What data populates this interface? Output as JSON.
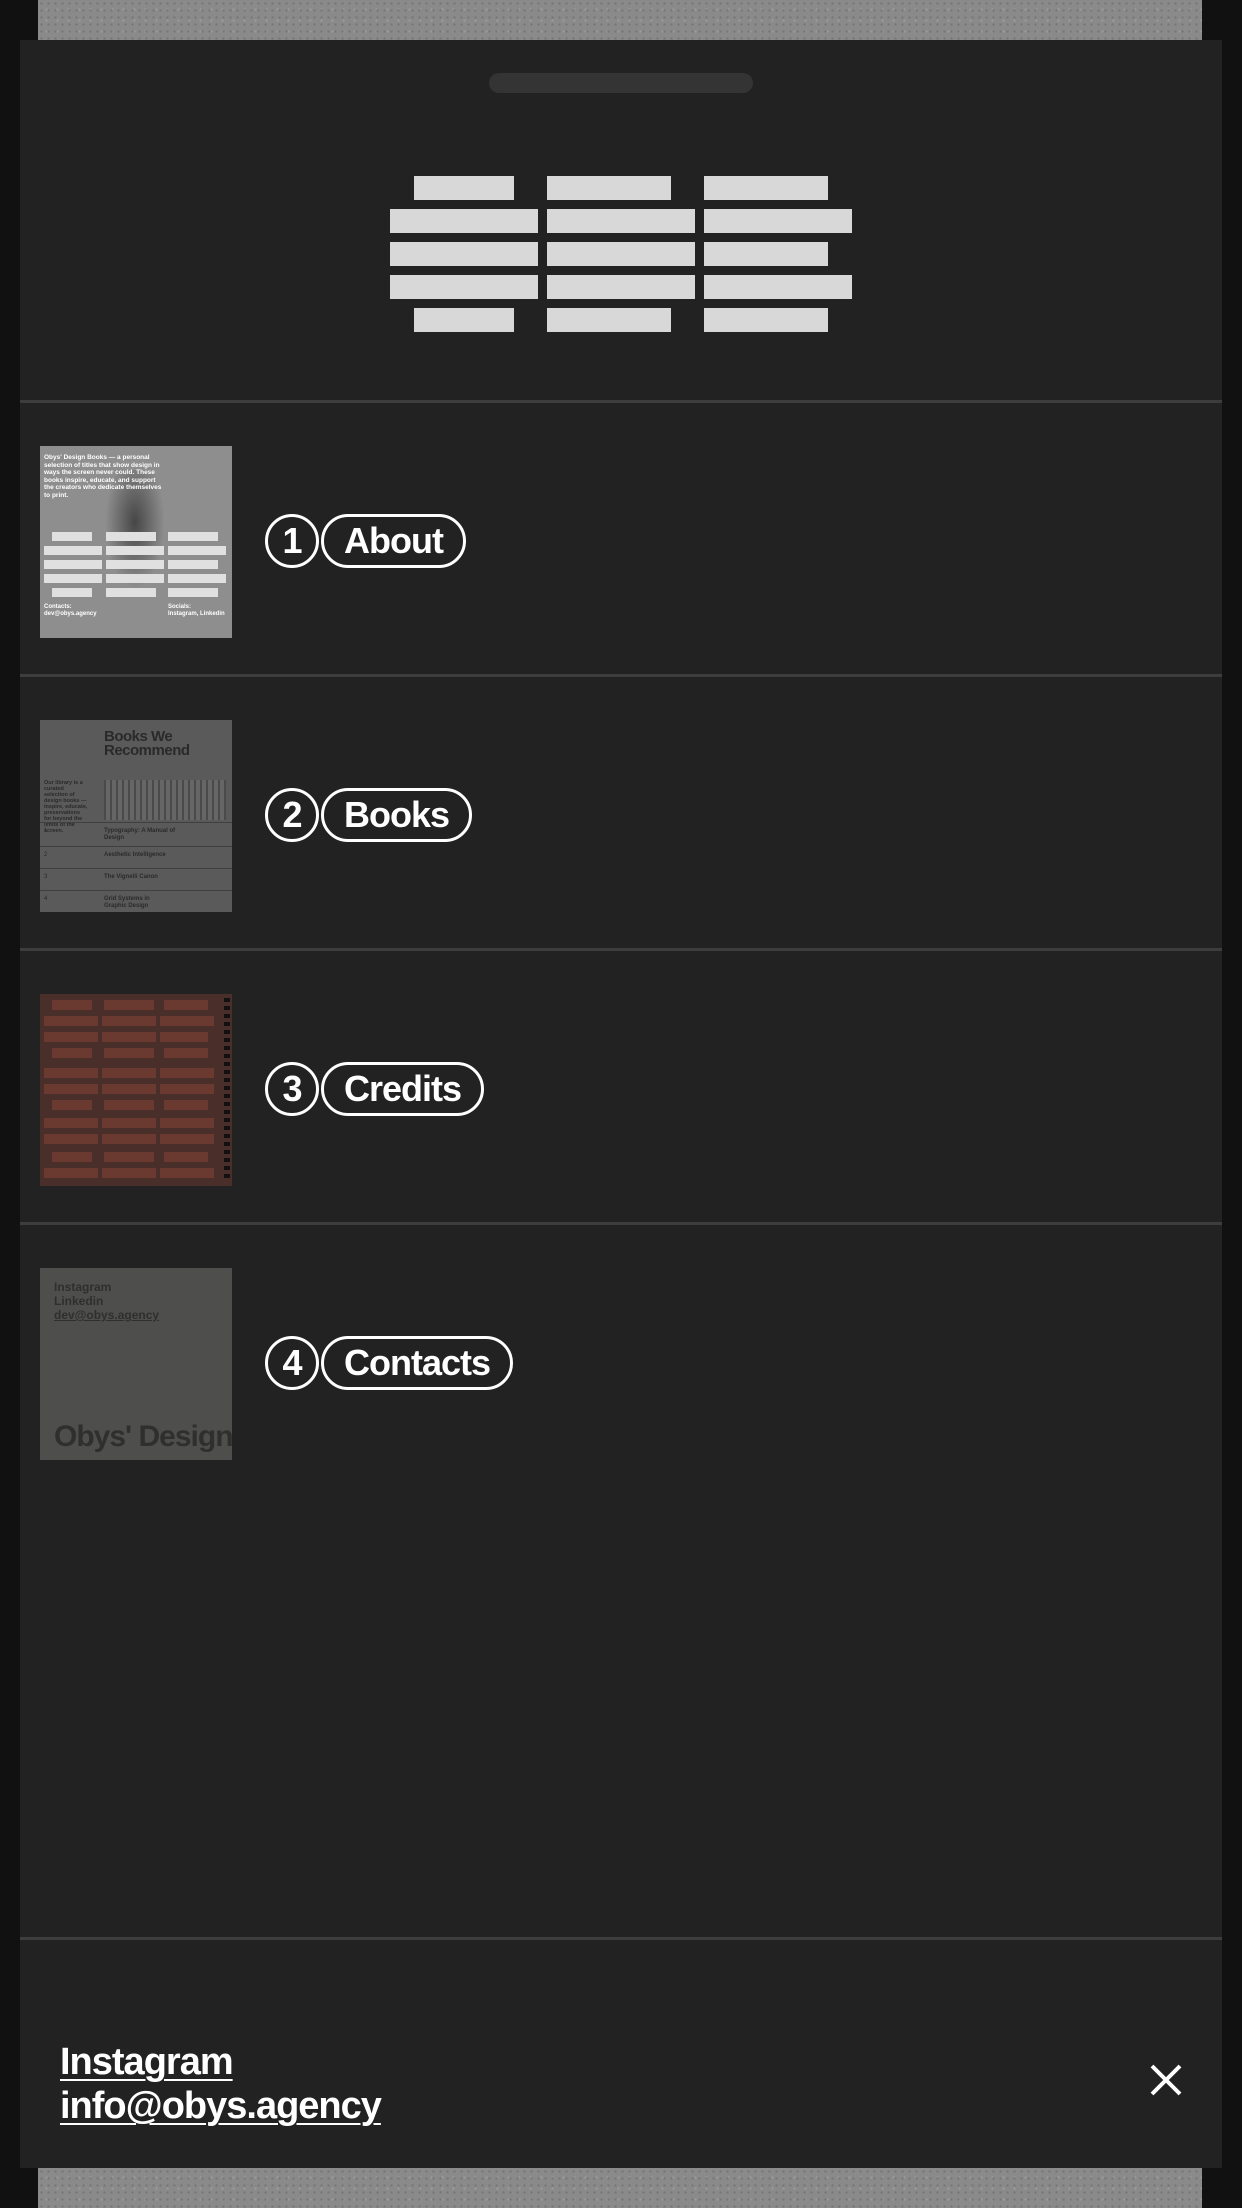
{
  "menu": {
    "items": [
      {
        "number": "1",
        "label": "About"
      },
      {
        "number": "2",
        "label": "Books"
      },
      {
        "number": "3",
        "label": "Credits"
      },
      {
        "number": "4",
        "label": "Contacts"
      }
    ]
  },
  "thumbnails": {
    "about": {
      "text": "Obys' Design Books — a personal selection of titles that show design in ways the screen never could. These books inspire, educate, and support the creators who dedicate themselves to print.",
      "contacts_label": "Contacts:",
      "contacts_value": "dev@obys.agency",
      "socials_label": "Socials:",
      "socials_value": "Instagram, Linkedin"
    },
    "books": {
      "title_line1": "Books We",
      "title_line2": "Recommend",
      "side_text": "Our library is a curated selection of design books — inspire, educate, preservations for beyond the limits of the screen.",
      "rows": [
        {
          "num": "1",
          "title": "Typography: A Manual of Design"
        },
        {
          "num": "2",
          "title": "Aesthetic Intelligence"
        },
        {
          "num": "3",
          "title": "The Vignelli Canon"
        },
        {
          "num": "4",
          "title": "Grid Systems in Graphic Design"
        }
      ]
    },
    "contacts": {
      "link1": "Instagram",
      "link2": "Linkedin",
      "link3": "dev@obys.agency",
      "big_text": "Obys' Design"
    }
  },
  "footer": {
    "instagram": "Instagram",
    "email": "info@obys.agency"
  },
  "icons": {
    "close": "close-icon",
    "logo": "obys-logo-icon"
  },
  "colors": {
    "sheet": "#222222",
    "text": "#ffffff",
    "logo": "#d8d8d8"
  }
}
